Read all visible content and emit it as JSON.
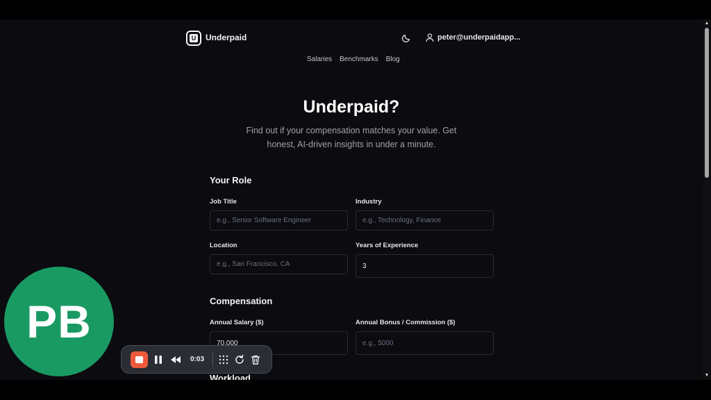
{
  "header": {
    "brand": "Underpaid",
    "logo_letter": "U",
    "user_email": "peter@underpaidapp..."
  },
  "nav": {
    "items": [
      "Salaries",
      "Benchmarks",
      "Blog"
    ]
  },
  "hero": {
    "title": "Underpaid?",
    "subtitle": "Find out if your compensation matches your value. Get honest, AI-driven insights in under a minute."
  },
  "form": {
    "role_section": "Your Role",
    "job_title_label": "Job Title",
    "job_title_placeholder": "e.g., Senior Software Engineer",
    "industry_label": "Industry",
    "industry_placeholder": "e.g., Technology, Finance",
    "location_label": "Location",
    "location_placeholder": "e.g., San Francisco, CA",
    "experience_label": "Years of Experience",
    "experience_value": "3",
    "compensation_section": "Compensation",
    "salary_label": "Annual Salary ($)",
    "salary_value": "70,000",
    "bonus_label": "Annual Bonus / Commission ($)",
    "bonus_placeholder": "e.g., 5000",
    "workload_section": "Workload"
  },
  "recorder": {
    "avatar_initials": "PB",
    "elapsed": "0:03"
  },
  "colors": {
    "background": "#0b0b10",
    "record_button": "#ef5a3c",
    "avatar": "#1a9a63"
  }
}
